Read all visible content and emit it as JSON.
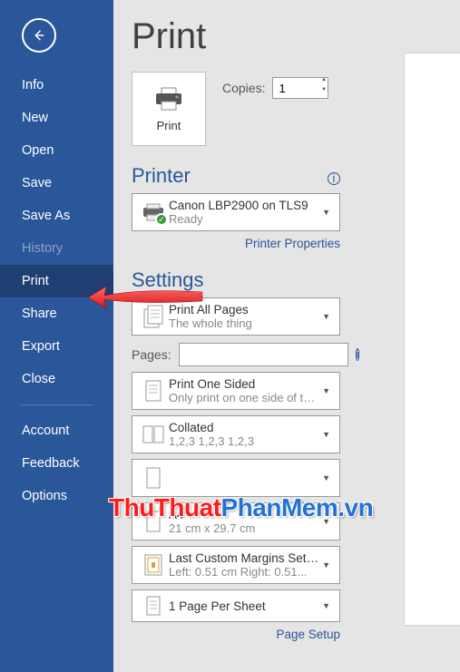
{
  "sidebar": {
    "items": [
      {
        "label": "Info"
      },
      {
        "label": "New"
      },
      {
        "label": "Open"
      },
      {
        "label": "Save"
      },
      {
        "label": "Save As"
      },
      {
        "label": "History"
      },
      {
        "label": "Print"
      },
      {
        "label": "Share"
      },
      {
        "label": "Export"
      },
      {
        "label": "Close"
      }
    ],
    "footer": [
      {
        "label": "Account"
      },
      {
        "label": "Feedback"
      },
      {
        "label": "Options"
      }
    ]
  },
  "page_title": "Print",
  "print_button_label": "Print",
  "copies": {
    "label": "Copies:",
    "value": "1"
  },
  "printer_section": "Printer",
  "printer": {
    "name": "Canon LBP2900 on TLS9",
    "status": "Ready"
  },
  "printer_properties": "Printer Properties",
  "settings_section": "Settings",
  "settings": {
    "print_all": {
      "title": "Print All Pages",
      "sub": "The whole thing"
    },
    "pages_label": "Pages:",
    "pages_value": "",
    "sided": {
      "title": "Print One Sided",
      "sub": "Only print on one side of th..."
    },
    "collated": {
      "title": "Collated",
      "sub": "1,2,3    1,2,3    1,2,3"
    },
    "orientation": {
      "title": "",
      "sub": ""
    },
    "paper": {
      "title": "A4",
      "sub": "21 cm x 29.7 cm"
    },
    "margins": {
      "title": "Last Custom Margins Setting",
      "sub": "Left:   0.51 cm    Right:   0.51..."
    },
    "sheet": {
      "title": "1 Page Per Sheet"
    }
  },
  "page_setup": "Page Setup",
  "watermark": {
    "part1": "ThuThuat",
    "part2": "PhanMem.vn"
  }
}
